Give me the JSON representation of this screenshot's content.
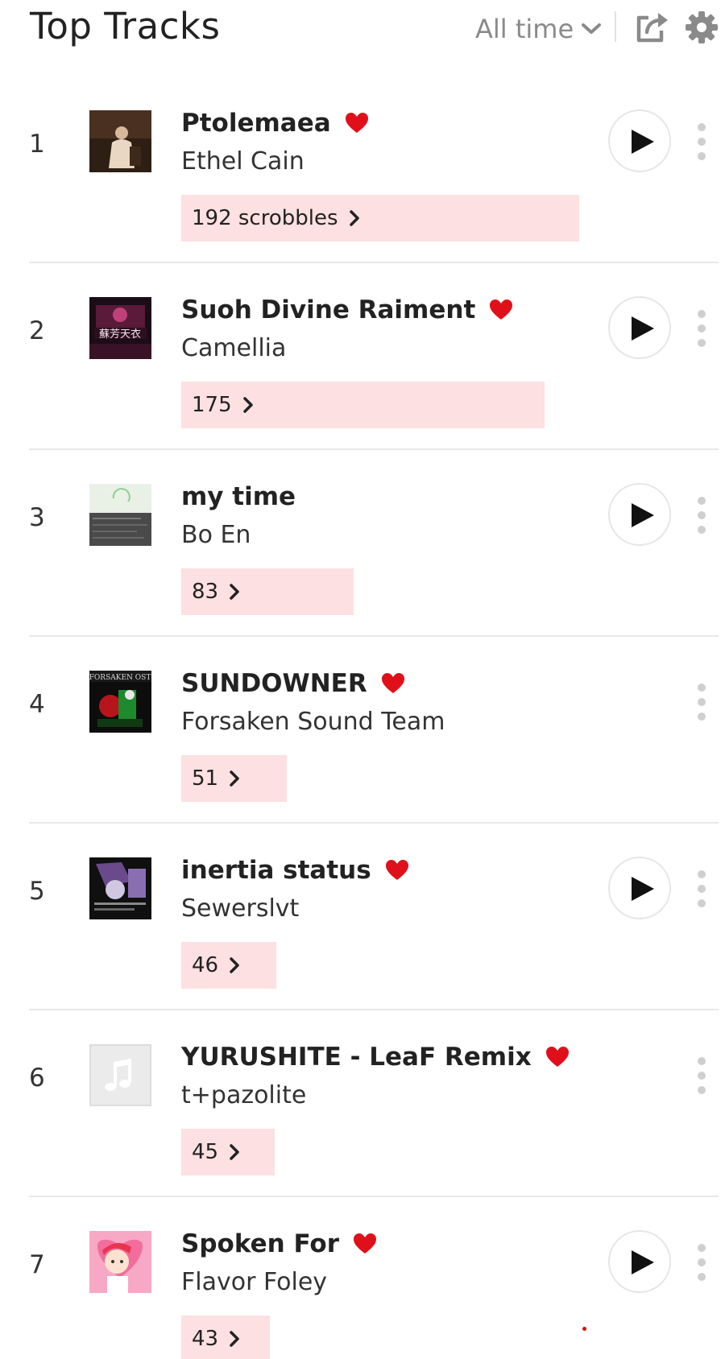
{
  "header": {
    "title": "Top Tracks",
    "period_label": "All time",
    "period_icon": "chevron-down-icon",
    "share_icon": "share-icon",
    "settings_icon": "gear-icon"
  },
  "colors": {
    "heart": "#e0101b",
    "scrobble_bar": "#fde0e1",
    "text": "#222222",
    "muted": "#8a8a8a"
  },
  "tracks": [
    {
      "rank": "1",
      "title": "Ptolemaea",
      "artist": "Ethel Cain",
      "scrobbles": "192 scrobbles",
      "count": 192,
      "loved": true,
      "playable": true,
      "art": "album-art"
    },
    {
      "rank": "2",
      "title": "Suoh Divine Raiment",
      "artist": "Camellia",
      "scrobbles": "175",
      "count": 175,
      "loved": true,
      "playable": true,
      "art": "album-art"
    },
    {
      "rank": "3",
      "title": "my time",
      "artist": "Bo En",
      "scrobbles": "83",
      "count": 83,
      "loved": false,
      "playable": true,
      "art": "album-art"
    },
    {
      "rank": "4",
      "title": "SUNDOWNER",
      "artist": "Forsaken Sound Team",
      "scrobbles": "51",
      "count": 51,
      "loved": true,
      "playable": false,
      "art": "album-art"
    },
    {
      "rank": "5",
      "title": "inertia status",
      "artist": "Sewerslvt",
      "scrobbles": "46",
      "count": 46,
      "loved": true,
      "playable": true,
      "art": "album-art"
    },
    {
      "rank": "6",
      "title": "YURUSHITE - LeaF Remix",
      "artist": "t+pazolite",
      "scrobbles": "45",
      "count": 45,
      "loved": true,
      "playable": false,
      "art": "music-note-placeholder"
    },
    {
      "rank": "7",
      "title": "Spoken For",
      "artist": "Flavor Foley",
      "scrobbles": "43",
      "count": 43,
      "loved": true,
      "playable": true,
      "art": "album-art"
    }
  ]
}
